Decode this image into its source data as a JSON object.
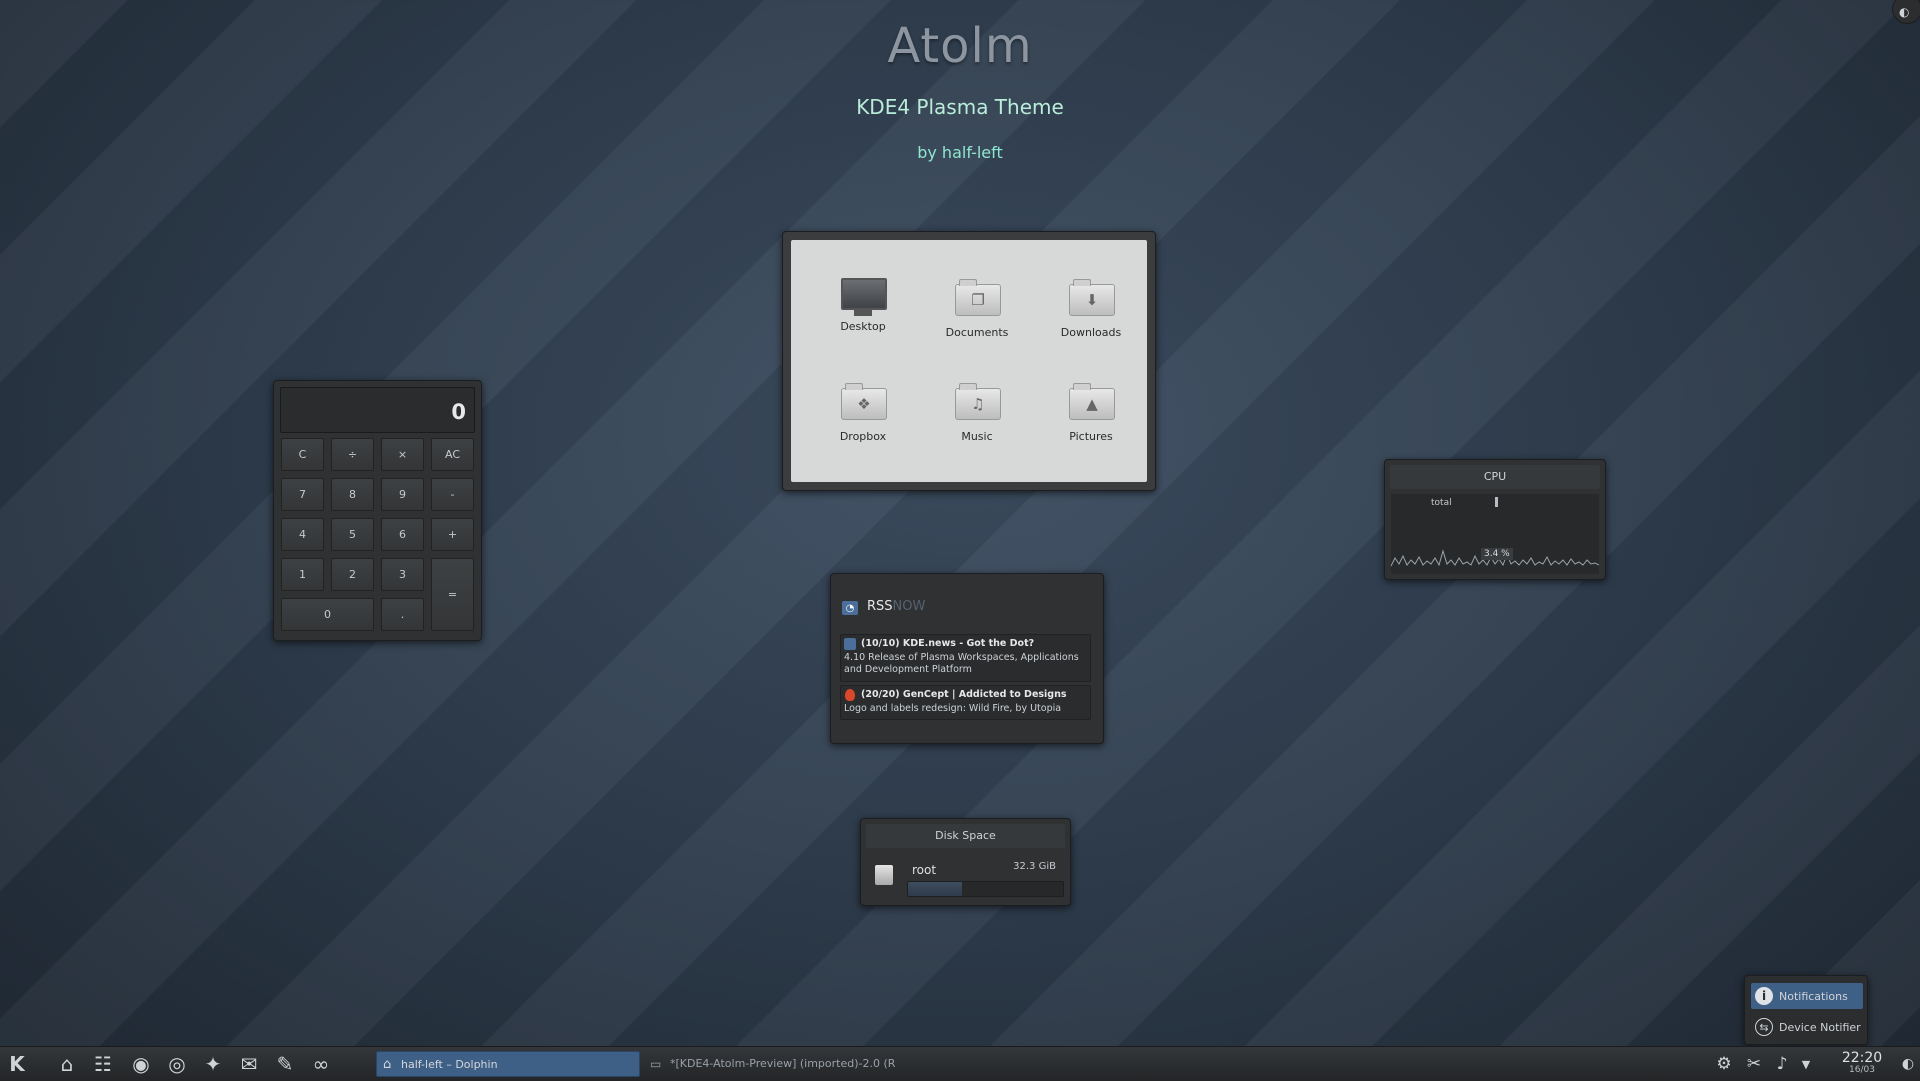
{
  "header": {
    "title": "Atolm",
    "subtitle": "KDE4 Plasma Theme",
    "byline": "by half-left"
  },
  "folderview": {
    "items": [
      {
        "label": "Desktop",
        "icon": "monitor-icon"
      },
      {
        "label": "Documents",
        "icon": "documents-folder-icon"
      },
      {
        "label": "Downloads",
        "icon": "downloads-folder-icon"
      },
      {
        "label": "Dropbox",
        "icon": "dropbox-folder-icon"
      },
      {
        "label": "Music",
        "icon": "music-folder-icon"
      },
      {
        "label": "Pictures",
        "icon": "pictures-folder-icon"
      }
    ]
  },
  "calculator": {
    "display": "0",
    "keys": {
      "c": "C",
      "div": "÷",
      "mul": "×",
      "ac": "AC",
      "k7": "7",
      "k8": "8",
      "k9": "9",
      "minus": "-",
      "k4": "4",
      "k5": "5",
      "k6": "6",
      "plus": "+",
      "k1": "1",
      "k2": "2",
      "k3": "3",
      "eq": "=",
      "k0": "0",
      "dot": "."
    }
  },
  "cpu": {
    "title": "CPU",
    "legend": "total",
    "value": "3.4 %"
  },
  "rss": {
    "title": "RSS",
    "title_suffix": "NOW",
    "items": [
      {
        "title": "(10/10) KDE.news - Got the Dot?",
        "desc": "4.10 Release of Plasma Workspaces, Applications and Development Platform"
      },
      {
        "title": "(20/20) GenCept | Addicted to Designs",
        "desc": "Logo and labels redesign: Wild Fire, by Utopia"
      }
    ]
  },
  "disk": {
    "title": "Disk Space",
    "mount": "root",
    "size": "32.3 GiB",
    "used_fraction": 0.35
  },
  "notifications": {
    "notifications_label": "Notifications",
    "device_notifier_label": "Device Notifier"
  },
  "taskbar": {
    "tasks": [
      {
        "label": "half-left – Dolphin",
        "active": true
      },
      {
        "label": "*[KDE4-Atolm-Preview] (imported)-2.0 (R",
        "active": false
      }
    ],
    "clock_time": "22:20",
    "clock_date": "16/03"
  },
  "colors": {
    "accent_text": "#8fe6cf",
    "panel": "#2f3133",
    "highlight": "#4b6f9a"
  }
}
